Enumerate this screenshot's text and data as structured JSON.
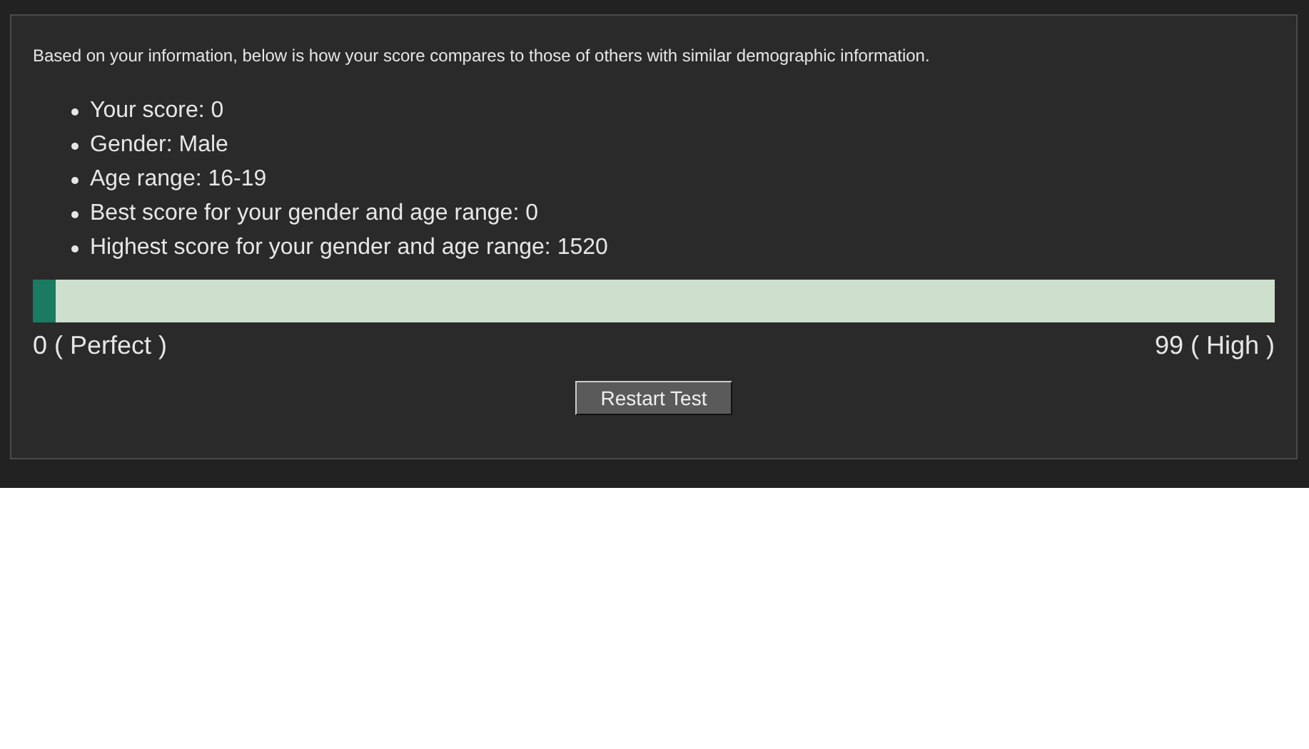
{
  "intro": "Based on your information, below is how your score compares to those of others with similar demographic information.",
  "facts": [
    "Your score: 0",
    "Gender: Male",
    "Age range: 16-19",
    "Best score for your gender and age range: 0",
    "Highest score for your gender and age range: 1520"
  ],
  "meter": {
    "level": 0.018,
    "min_label": "0 ( Perfect )",
    "max_label": "99 ( High )"
  },
  "button": "Restart Test"
}
